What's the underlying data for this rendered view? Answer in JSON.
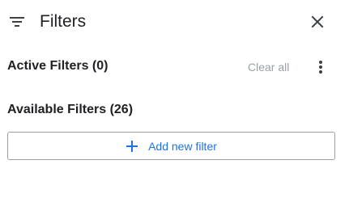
{
  "panel": {
    "title": "Filters",
    "icons": {
      "filter": "filter-list-icon",
      "close": "close-icon",
      "more": "more-vert-icon",
      "add": "plus-icon"
    }
  },
  "active_filters": {
    "title": "Active Filters (0)",
    "clear_all_label": "Clear all"
  },
  "available_filters": {
    "title": "Available Filters (26)",
    "add_button_label": "Add new filter"
  },
  "colors": {
    "text": "#202124",
    "muted": "#9aa0a6",
    "accent": "#1a73e8",
    "border": "#9aa0a6"
  }
}
